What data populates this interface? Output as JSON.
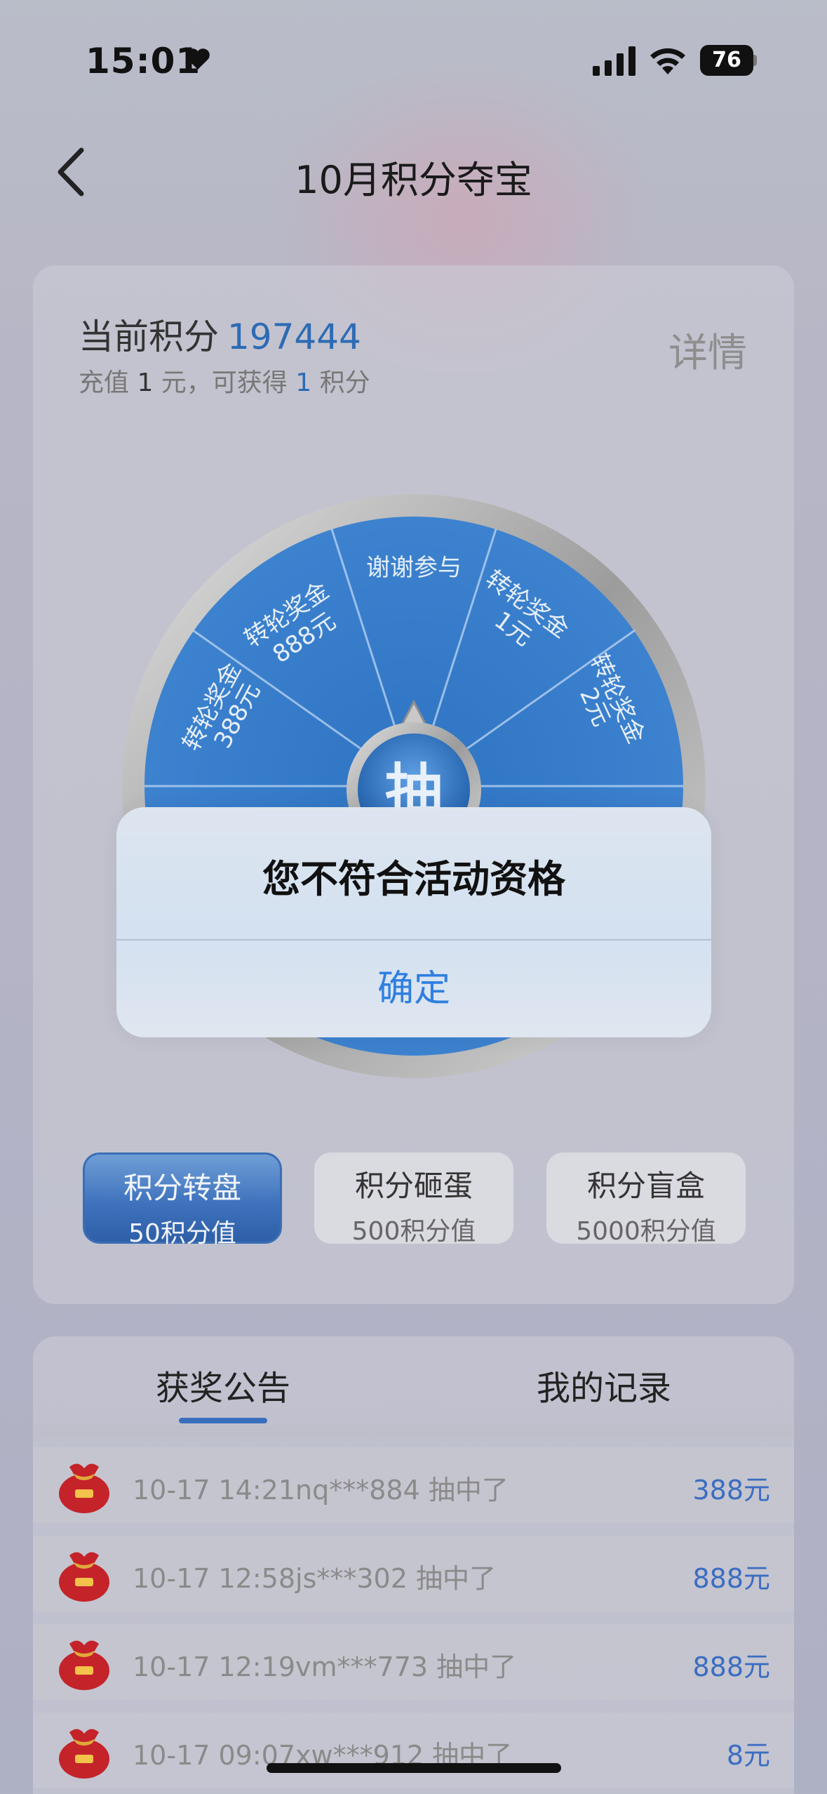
{
  "status_bar": {
    "time": "15:01",
    "battery": "76"
  },
  "nav": {
    "title": "10月积分夺宝"
  },
  "points": {
    "label": "当前积分",
    "value": "197444",
    "sub_prefix": "充值 ",
    "sub_amount": "1",
    "sub_middle": " 元，可获得 ",
    "sub_points": "1",
    "sub_suffix": " 积分",
    "detail": "详情"
  },
  "wheel": {
    "segments": [
      {
        "line1": "谢谢参与",
        "line2": ""
      },
      {
        "line1": "转轮奖金",
        "line2": "1元"
      },
      {
        "line1": "转轮奖金",
        "line2": "2元"
      },
      {
        "line1": "转轮奖金",
        "line2": "888元"
      },
      {
        "line1": "转轮奖金",
        "line2": "388元"
      }
    ],
    "center_label": "抽"
  },
  "game_tabs": [
    {
      "title": "积分转盘",
      "cost": "50积分值",
      "active": true
    },
    {
      "title": "积分砸蛋",
      "cost": "500积分值",
      "active": false
    },
    {
      "title": "积分盲盒",
      "cost": "5000积分值",
      "active": false
    }
  ],
  "list_tabs": {
    "announce": "获奖公告",
    "records": "我的记录"
  },
  "winners": [
    {
      "text": "10-17 14:21nq***884 抽中了",
      "amount": "388元"
    },
    {
      "text": "10-17 12:58js***302 抽中了",
      "amount": "888元"
    },
    {
      "text": "10-17 12:19vm***773 抽中了",
      "amount": "888元"
    },
    {
      "text": "10-17 09:07xw***912 抽中了",
      "amount": "8元"
    }
  ],
  "dialog": {
    "title": "您不符合活动资格",
    "confirm": "确定"
  },
  "colors": {
    "accent": "#2f7fe0",
    "wheel_blue": "#2a6cb8",
    "points_blue": "#2d6bb4",
    "amount_blue": "#3b6dc1"
  }
}
